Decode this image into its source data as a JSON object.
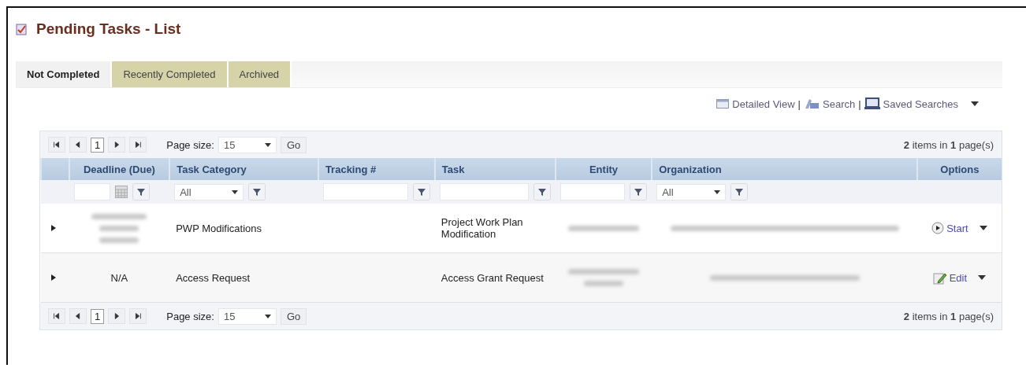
{
  "page": {
    "title": "Pending Tasks - List"
  },
  "tabs": [
    {
      "label": "Not Completed",
      "selected": true
    },
    {
      "label": "Recently Completed",
      "selected": false
    },
    {
      "label": "Archived",
      "selected": false
    }
  ],
  "toolbar": {
    "links": [
      {
        "label": "Detailed View",
        "kind": "view",
        "separator": "|"
      },
      {
        "label": "Search",
        "kind": "search",
        "separator": "|"
      },
      {
        "label": "Saved Searches",
        "kind": "saved"
      }
    ]
  },
  "pager_top": {
    "page": "1",
    "page_size_label": "Page size:",
    "page_size": "15",
    "go": "Go",
    "summary": "**2** items in **1** page(s)"
  },
  "table": {
    "columns": [
      {
        "label": "Deadline (Due)",
        "kind": "date"
      },
      {
        "label": "Task Category",
        "kind": "select",
        "value": "All"
      },
      {
        "label": "Tracking #",
        "kind": "text"
      },
      {
        "label": "Task",
        "kind": "text"
      },
      {
        "label": "Entity",
        "kind": "text"
      },
      {
        "label": "Organization",
        "kind": "select",
        "value": "All"
      },
      {
        "label": "Options",
        "kind": "none"
      }
    ],
    "rows": [
      {
        "expanded": false,
        "deadline": {
          "kind": "redacted_tall"
        },
        "category": "PWP Modifications",
        "task": "Project Work Plan Modification",
        "entity": {
          "kind": "redacted_single"
        },
        "organization": {
          "kind": "redacted_wide"
        },
        "action": {
          "label": "Start",
          "kind": "start"
        }
      },
      {
        "expanded": false,
        "deadline": {
          "kind": "text",
          "text": "N/A"
        },
        "category": "Access Request",
        "task": "Access Grant Request",
        "entity": {
          "kind": "redacted_double"
        },
        "organization": {
          "kind": "redacted_medium"
        },
        "action": {
          "label": "Edit",
          "kind": "edit"
        }
      }
    ]
  },
  "pager_bottom": {
    "page": "1",
    "page_size_label": "Page size:",
    "page_size": "15",
    "go": "Go",
    "summary": "**2** items in **1** page(s)"
  }
}
